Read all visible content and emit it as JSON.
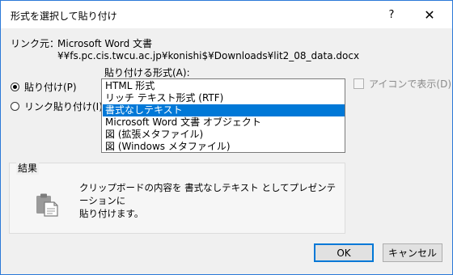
{
  "window": {
    "title": "形式を選択して貼り付け",
    "help_glyph": "?",
    "close_glyph": "✕"
  },
  "source": {
    "label": "リンク元：",
    "name": "Microsoft Word 文書",
    "path": "¥¥fs.pc.cis.twcu.ac.jp¥konishi$¥Downloads¥lit2_08_data.docx"
  },
  "format_label": "貼り付ける形式(A):",
  "radios": {
    "paste": {
      "label": "貼り付け(P)",
      "checked": true
    },
    "link": {
      "label": "リンク貼り付け(I)",
      "checked": false
    }
  },
  "formats": [
    {
      "label": "HTML 形式",
      "selected": false
    },
    {
      "label": "リッチ テキスト形式 (RTF)",
      "selected": false
    },
    {
      "label": "書式なしテキスト",
      "selected": true
    },
    {
      "label": "Microsoft Word 文書 オブジェクト",
      "selected": false
    },
    {
      "label": "図 (拡張メタファイル)",
      "selected": false
    },
    {
      "label": "図 (Windows メタファイル)",
      "selected": false
    }
  ],
  "display_as_icon": {
    "label": "アイコンで表示(D)",
    "checked": false,
    "disabled": true
  },
  "result": {
    "label": "結果",
    "line1": "クリップボードの内容を 書式なしテキスト としてプレゼンテーションに",
    "line2": "貼り付けます。",
    "icon": "paste-clipboard-icon"
  },
  "buttons": {
    "ok": "OK",
    "cancel": "キャンセル"
  },
  "colors": {
    "accent": "#0078d7",
    "window_border": "#2b79d8"
  }
}
